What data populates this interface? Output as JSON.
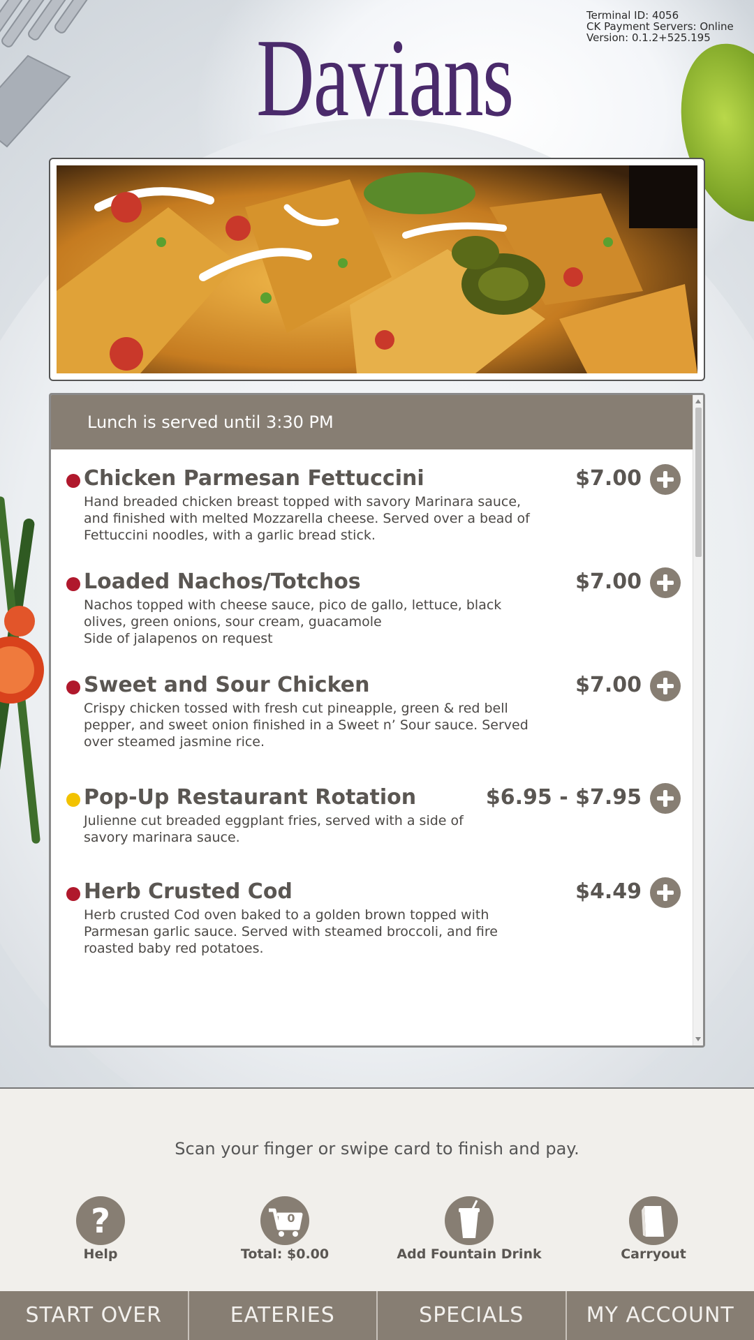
{
  "status": {
    "terminal": "Terminal ID: 4056",
    "payment": "CK Payment Servers: Online",
    "version": "Version: 0.1.2+525.195"
  },
  "brand": {
    "logo_text": "Davians",
    "logo_color": "#4a2a6b"
  },
  "menu": {
    "header": "Lunch is served until 3:30 PM",
    "items": [
      {
        "name": "Chicken Parmesan Fettuccini",
        "desc": "Hand breaded chicken breast topped with savory Marinara sauce, and finished with melted Mozzarella cheese. Served over a bead of Fettuccini noodles, with a garlic bread stick.",
        "price": "$7.00",
        "dot_color": "#b0182c"
      },
      {
        "name": "Loaded Nachos/Totchos",
        "desc_lines": [
          "Nachos topped with cheese sauce, pico de gallo, lettuce, black olives, green onions, sour cream, guacamole",
          "Side of jalapenos on request"
        ],
        "price": "$7.00",
        "dot_color": "#b0182c"
      },
      {
        "name": "Sweet and Sour Chicken",
        "desc": "Crispy chicken tossed with fresh cut pineapple, green & red bell pepper, and sweet onion finished in a Sweet n’ Sour sauce. Served over steamed jasmine rice.",
        "price": "$7.00",
        "dot_color": "#b0182c"
      },
      {
        "name": "Pop-Up Restaurant Rotation",
        "desc": "Julienne cut breaded eggplant fries, served with a side of savory marinara sauce.",
        "price": "$6.95 - $7.95",
        "dot_color": "#f2c200"
      },
      {
        "name": "Herb Crusted Cod",
        "desc": "Herb crusted Cod oven baked to a golden brown topped with Parmesan garlic sauce. Served with steamed broccoli, and fire roasted baby red potatoes.",
        "price": "$4.49",
        "dot_color": "#b0182c"
      }
    ]
  },
  "footer": {
    "scan_text": "Scan your finger or swipe card to finish and pay.",
    "cart_count": "0",
    "actions": [
      {
        "label": "Help",
        "icon": "help-icon"
      },
      {
        "label": "Total: $0.00",
        "icon": "cart-icon"
      },
      {
        "label": "Add Fountain Drink",
        "icon": "cup-icon"
      },
      {
        "label": "Carryout",
        "icon": "bag-icon"
      }
    ]
  },
  "nav": [
    "START OVER",
    "EATERIES",
    "SPECIALS",
    "MY ACCOUNT"
  ],
  "colors": {
    "accent": "#877e73",
    "header_text": "#ffffff",
    "panel_bg": "#f1efeb"
  }
}
